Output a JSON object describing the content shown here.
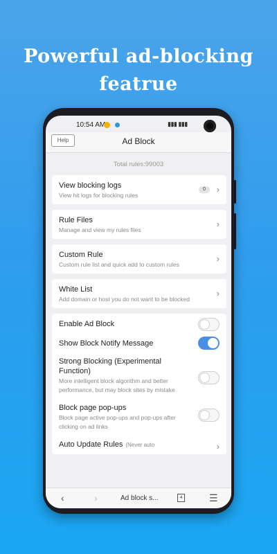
{
  "headline": {
    "line1": "Powerful ad-blocking",
    "line2": "featrue"
  },
  "status_bar": {
    "time": "10:54 AM"
  },
  "header": {
    "help_label": "Help",
    "title": "Ad Block"
  },
  "total_rules": "Total rules:99003",
  "cards": [
    {
      "title": "View blocking logs",
      "subtitle": "View hit logs for blocking rules",
      "badge": "0"
    },
    {
      "title": "Rule Files",
      "subtitle": "Manage and view my rules files"
    },
    {
      "title": "Custom Rule",
      "subtitle": "Custom rule list and quick add to custom rules"
    },
    {
      "title": "White List",
      "subtitle": "Add domain or host you do not want to be blocked"
    }
  ],
  "settings": [
    {
      "label": "Enable Ad Block",
      "enabled": false
    },
    {
      "label": "Show Block Notify Message",
      "enabled": true
    },
    {
      "label": "Strong Blocking (Experimental Function)",
      "sub": "More intelligent block algorithm and better performance, but may block sites by mistake",
      "enabled": false
    },
    {
      "label": "Block page pop-ups",
      "sub": "Block page active pop-ups and pop-ups after clicking on ad links",
      "enabled": false
    },
    {
      "label": "Auto Update Rules",
      "note": "(Never auto"
    }
  ],
  "bottom_nav": {
    "url": "Ad block s...",
    "tab_count": "4"
  },
  "colors": {
    "accent": "#4a8fe6",
    "background_top": "#4ba4ea",
    "background_bottom": "#1aa6f2"
  }
}
